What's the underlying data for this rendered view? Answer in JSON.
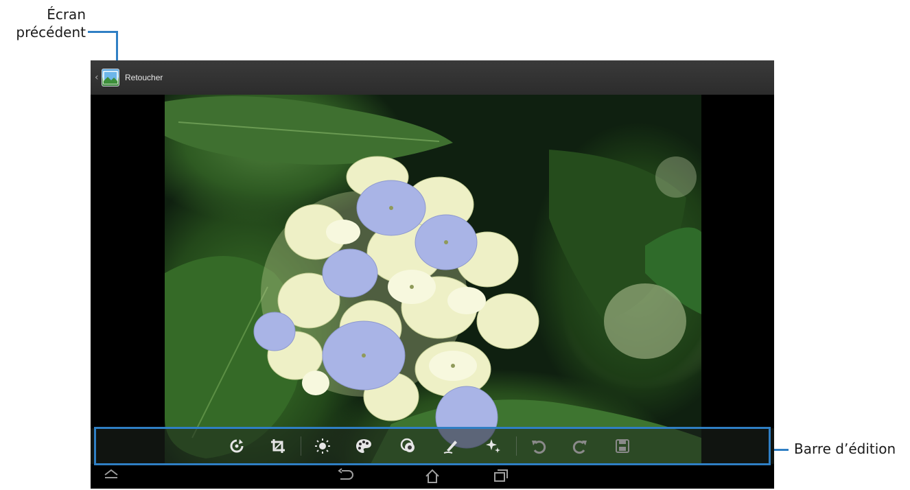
{
  "callouts": {
    "previous_screen": [
      "Écran",
      "précédent"
    ],
    "edit_bar": "Barre d’édition"
  },
  "action_bar": {
    "back_chevron": "‹",
    "title": "Retoucher"
  },
  "edit_toolbar": {
    "tools": [
      {
        "name": "rotate-icon"
      },
      {
        "name": "crop-icon"
      },
      {
        "name": "brightness-icon"
      },
      {
        "name": "color-palette-icon"
      },
      {
        "name": "effects-icon"
      },
      {
        "name": "draw-icon"
      },
      {
        "name": "sparkle-icon"
      },
      {
        "name": "undo-icon"
      },
      {
        "name": "redo-icon"
      },
      {
        "name": "save-icon"
      }
    ]
  },
  "nav_bar": {
    "buttons": [
      "hide-keyboard-icon",
      "back-icon",
      "home-icon",
      "recent-apps-icon"
    ]
  },
  "colors": {
    "callout_line": "#2f7fc4",
    "action_bar_bg": "#333333",
    "toolbar_icon": "#e6e6e6",
    "disabled_icon": "#8a8a8a"
  }
}
